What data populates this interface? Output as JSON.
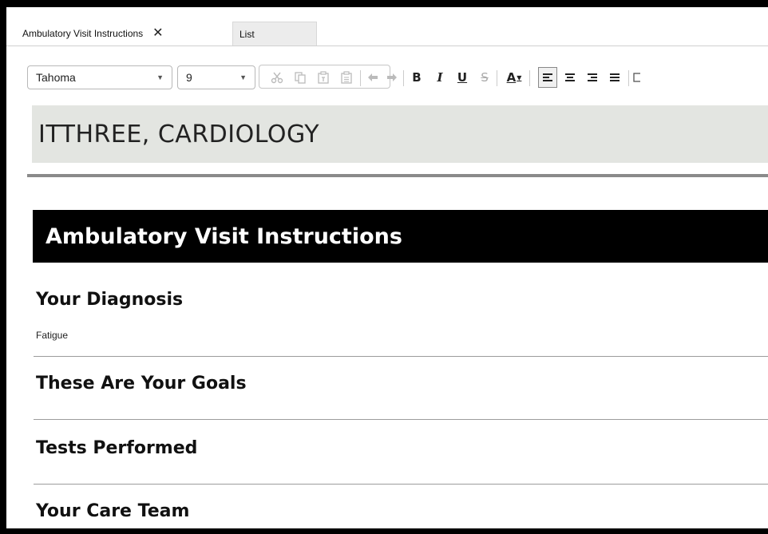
{
  "tabs": [
    {
      "label": "Ambulatory Visit Instructions",
      "close_glyph": "✕",
      "active": true
    },
    {
      "label": "List",
      "active": false
    }
  ],
  "toolbar": {
    "font_family": "Tahoma",
    "font_size": "9",
    "dropdown_arrow": "▼",
    "bold": "B",
    "italic": "I",
    "underline": "U",
    "strike": "S",
    "font_color": "A"
  },
  "document": {
    "patient_name": "ITTHREE, CARDIOLOGY",
    "section_title": "Ambulatory Visit Instructions",
    "sections": [
      {
        "heading": "Your Diagnosis",
        "body": "Fatigue"
      },
      {
        "heading": "These Are Your Goals",
        "body": ""
      },
      {
        "heading": "Tests Performed",
        "body": ""
      },
      {
        "heading": "Your Care Team",
        "body": ""
      }
    ]
  },
  "colors": {
    "name_bar": "#e3e5e1",
    "title_bar": "#000000",
    "frame": "#000000"
  }
}
